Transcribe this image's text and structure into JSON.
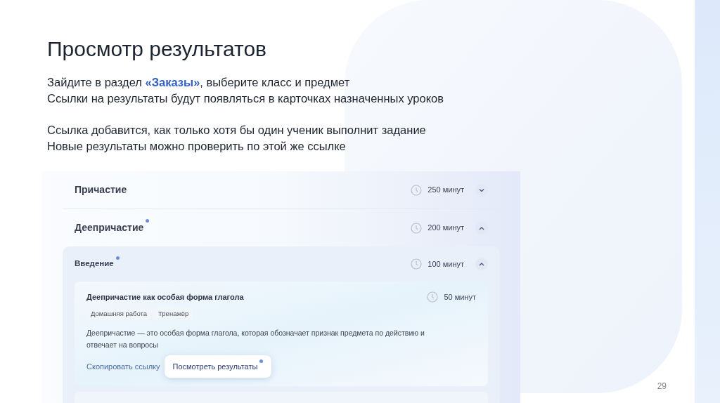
{
  "slide": {
    "title": "Просмотр результатов",
    "paragraphs": [
      [
        "Зайдите в раздел **«Заказы»**, выберите класс и предмет",
        "Ссылки на результаты будут появляться в карточках назначенных уроков"
      ],
      [
        "Ссылка добавится, как только хотя бы один ученик выполнит задание",
        "Новые результаты можно проверить по этой же ссылке"
      ]
    ],
    "page_number": "29"
  },
  "app": {
    "sections": [
      {
        "title": "Причастие",
        "duration": "250 минут",
        "expanded": false,
        "new": false
      },
      {
        "title": "Деепричастие",
        "duration": "200 минут",
        "expanded": true,
        "new": true,
        "children": [
          {
            "title": "Введение",
            "duration": "100 минут",
            "expanded": true,
            "new": true,
            "lessons": [
              {
                "title": "Деепричастие как особая форма глагола",
                "duration": "50 минут",
                "tags": [
                  "Домашняя работа",
                  "Тренажёр"
                ],
                "description": "Деепричастие — это особая форма глагола, которая обозначает признак предмета по действию и отвечает на вопросы",
                "copy_link": "Скопировать ссылку",
                "results_button": {
                  "label": "Посмотреть результаты",
                  "new": true
                }
              }
            ]
          }
        ]
      }
    ]
  }
}
